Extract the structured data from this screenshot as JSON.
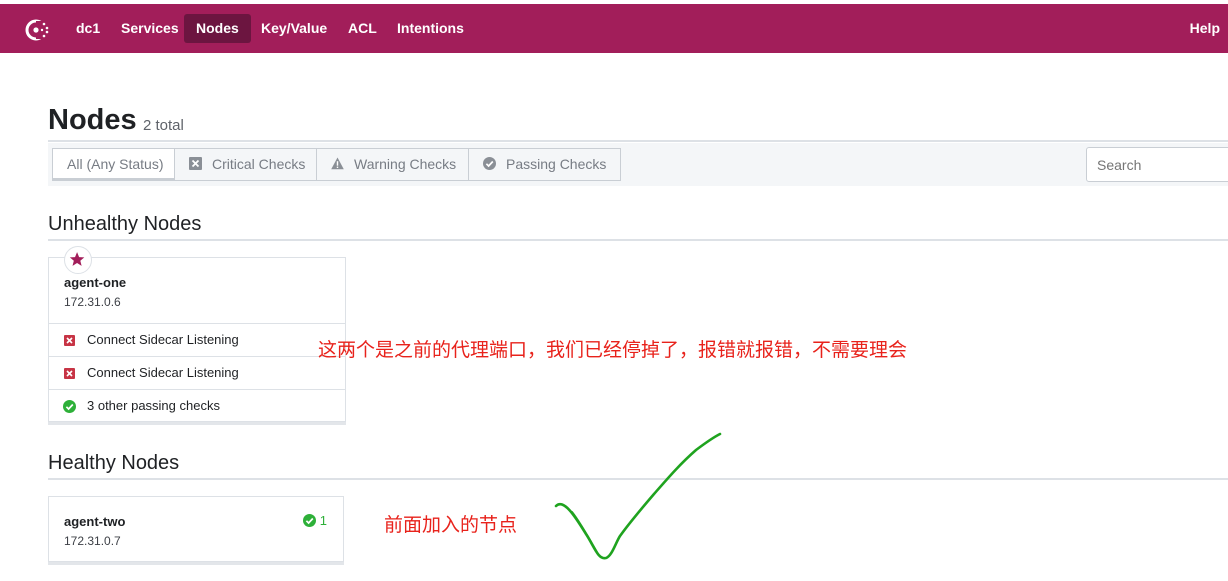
{
  "nav": {
    "datacenter": "dc1",
    "items": [
      {
        "label": "Services",
        "active": false
      },
      {
        "label": "Nodes",
        "active": true
      },
      {
        "label": "Key/Value",
        "active": false
      },
      {
        "label": "ACL",
        "active": false
      },
      {
        "label": "Intentions",
        "active": false
      }
    ],
    "help": "Help"
  },
  "header": {
    "title": "Nodes",
    "count": "2 total"
  },
  "filters": {
    "options": [
      {
        "label": "All (Any Status)",
        "icon": "none",
        "selected": true
      },
      {
        "label": "Critical Checks",
        "icon": "x-square-icon",
        "selected": false
      },
      {
        "label": "Warning Checks",
        "icon": "warning-triangle-icon",
        "selected": false
      },
      {
        "label": "Passing Checks",
        "icon": "check-circle-icon",
        "selected": false
      }
    ],
    "search_placeholder": "Search"
  },
  "unhealthy": {
    "title": "Unhealthy Nodes",
    "node": {
      "name": "agent-one",
      "address": "172.31.0.6",
      "leader_icon": "star-icon",
      "checks": [
        {
          "label": "Connect Sidecar Listening",
          "status": "critical"
        },
        {
          "label": "Connect Sidecar Listening",
          "status": "critical"
        },
        {
          "label": "3 other passing checks",
          "status": "passing"
        }
      ]
    }
  },
  "healthy": {
    "title": "Healthy Nodes",
    "node": {
      "name": "agent-two",
      "address": "172.31.0.7",
      "passing_count": "1"
    }
  },
  "annotations": {
    "note_ports": "这两个是之前的代理端口，我们已经停掉了，报错就报错，不需要理会",
    "note_new_node": "前面加入的节点"
  },
  "colors": {
    "brand": "#a21e5a",
    "brand_active": "#6c1540",
    "critical": "#c73445",
    "passing": "#2eb039",
    "annotation_red": "#e8221b",
    "annotation_green": "#1fa31f"
  }
}
